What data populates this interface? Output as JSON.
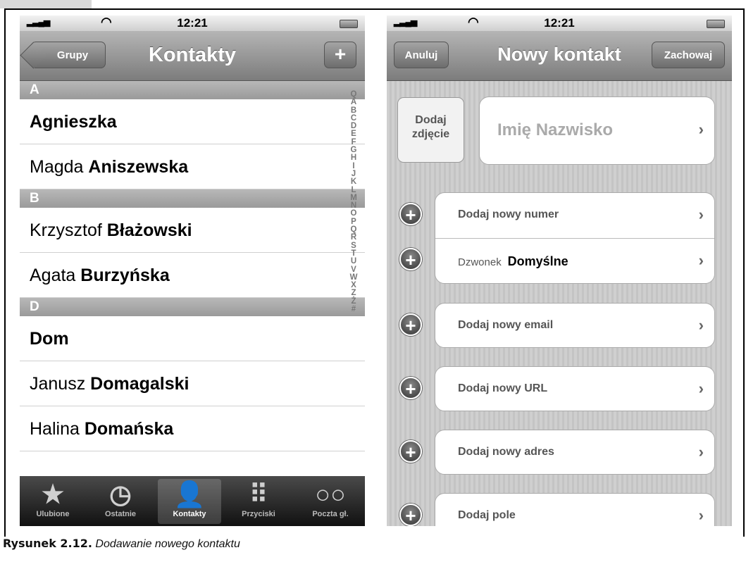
{
  "caption": {
    "label": "Rysunek 2.12.",
    "text": "Dodawanie nowego kontaktu"
  },
  "status": {
    "time": "12:21"
  },
  "left": {
    "nav": {
      "back": "Grupy",
      "title": "Kontakty",
      "add": "+"
    },
    "sections": [
      {
        "letter": "A",
        "rows": [
          {
            "first": "",
            "last": "Agnieszka"
          },
          {
            "first": "Magda",
            "last": "Aniszewska"
          }
        ]
      },
      {
        "letter": "B",
        "rows": [
          {
            "first": "Krzysztof",
            "last": "Błażowski"
          },
          {
            "first": "Agata",
            "last": "Burzyńska"
          }
        ]
      },
      {
        "letter": "D",
        "rows": [
          {
            "first": "",
            "last": "Dom"
          },
          {
            "first": "Janusz",
            "last": "Domagalski"
          },
          {
            "first": "Halina",
            "last": "Domańska"
          }
        ]
      }
    ],
    "index": [
      "Q",
      "A",
      "B",
      "C",
      "D",
      "E",
      "F",
      "G",
      "H",
      "I",
      "J",
      "K",
      "L",
      "M",
      "N",
      "O",
      "P",
      "Q",
      "R",
      "S",
      "T",
      "U",
      "V",
      "W",
      "X",
      "Z",
      "Ż",
      "#"
    ],
    "tabs": [
      {
        "label": "Ulubione",
        "icon": "star-icon",
        "glyph": "★"
      },
      {
        "label": "Ostatnie",
        "icon": "clock-icon",
        "glyph": "◷"
      },
      {
        "label": "Kontakty",
        "icon": "person-icon",
        "glyph": "👤"
      },
      {
        "label": "Przyciski",
        "icon": "keypad-icon",
        "glyph": "⠿"
      },
      {
        "label": "Poczta gł.",
        "icon": "voicemail-icon",
        "glyph": "○○"
      }
    ]
  },
  "right": {
    "nav": {
      "cancel": "Anuluj",
      "title": "Nowy kontakt",
      "save": "Zachowaj"
    },
    "photo": {
      "line1": "Dodaj",
      "line2": "zdjęcie"
    },
    "name_placeholder": "Imię Nazwisko",
    "add_phone": "Dodaj nowy numer",
    "ringtone_label": "Dzwonek",
    "ringtone_value": "Domyślne",
    "add_email": "Dodaj nowy email",
    "add_url": "Dodaj nowy URL",
    "add_address": "Dodaj nowy adres",
    "add_field": "Dodaj pole",
    "chevron": "›"
  }
}
